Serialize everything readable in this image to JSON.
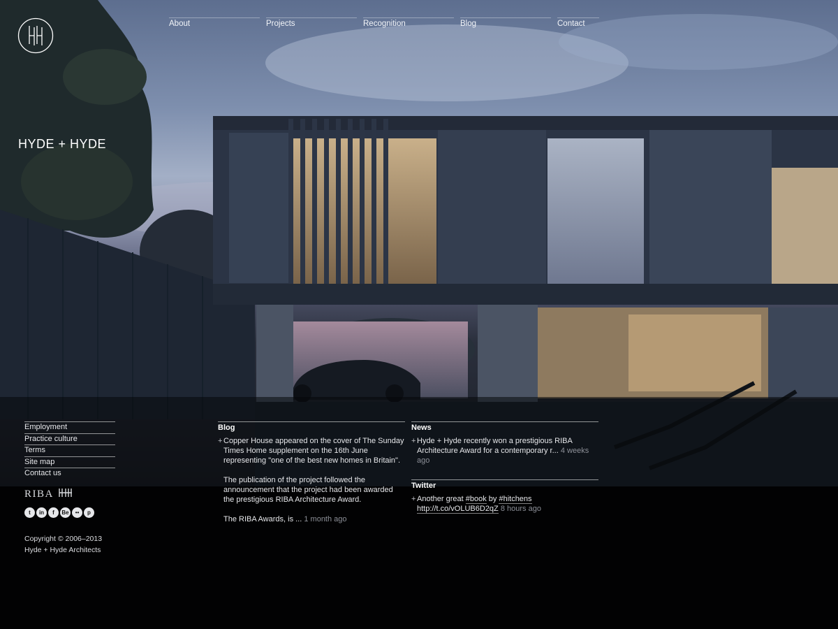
{
  "brand": {
    "name": "HYDE + HYDE",
    "logo_icon": "hh-monogram-icon"
  },
  "nav": {
    "items": [
      {
        "label": "About"
      },
      {
        "label": "Projects"
      },
      {
        "label": "Recognition"
      },
      {
        "label": "Blog"
      },
      {
        "label": "Contact"
      }
    ]
  },
  "footer": {
    "links": [
      {
        "label": "Employment"
      },
      {
        "label": "Practice culture"
      },
      {
        "label": "Terms"
      },
      {
        "label": "Site map"
      },
      {
        "label": "Contact us"
      }
    ],
    "riba": "RIBA",
    "social_icons": [
      "twitter-icon",
      "linkedin-icon",
      "facebook-icon",
      "behance-icon",
      "flickr-icon",
      "pinterest-icon"
    ],
    "copyright": {
      "line1": "Copyright © 2006–2013",
      "line2": "Hyde + Hyde Architects"
    }
  },
  "blog": {
    "title": "Blog",
    "paragraphs": [
      "Copper House appeared on the cover of The Sunday Times Home supplement on the 16th June representing \"one of the best new homes in Britain\".",
      "The publication of the project followed the announcement that the project had been awarded the prestigious RIBA Architecture Award.",
      "The RIBA Awards, is ..."
    ],
    "time": "1 month ago"
  },
  "news": {
    "title": "News",
    "text": "Hyde + Hyde recently won a prestigious RIBA Architecture Award for a contemporary r...",
    "time": "4 weeks ago"
  },
  "twitter": {
    "title": "Twitter",
    "text_prefix": "Another great",
    "hashtag1": "#book",
    "by": "by",
    "hashtag2": "#hitchens",
    "link": "http://t.co/vOLUB6D2qZ",
    "time": "8 hours ago"
  },
  "colors": {
    "background": "#030304",
    "text": "#ffffff",
    "muted": "#8d9098"
  }
}
